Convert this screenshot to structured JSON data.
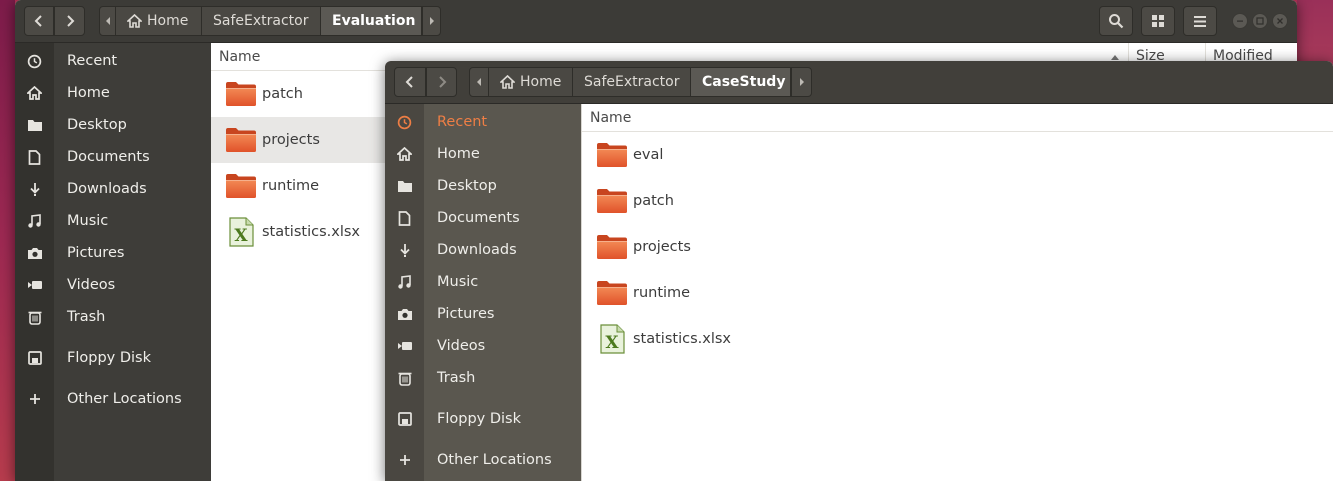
{
  "back_window": {
    "breadcrumbs": [
      "Home",
      "SafeExtractor",
      "Evaluation"
    ],
    "columns": {
      "name": "Name",
      "size": "Size",
      "modified": "Modified"
    },
    "sidebar": [
      {
        "label": "Recent",
        "icon": "clock-icon"
      },
      {
        "label": "Home",
        "icon": "home-icon"
      },
      {
        "label": "Desktop",
        "icon": "folder-icon"
      },
      {
        "label": "Documents",
        "icon": "document-icon"
      },
      {
        "label": "Downloads",
        "icon": "download-icon"
      },
      {
        "label": "Music",
        "icon": "music-icon"
      },
      {
        "label": "Pictures",
        "icon": "camera-icon"
      },
      {
        "label": "Videos",
        "icon": "video-icon"
      },
      {
        "label": "Trash",
        "icon": "trash-icon"
      },
      {
        "label": "Floppy Disk",
        "icon": "floppy-icon"
      },
      {
        "label": "Other Locations",
        "icon": "plus-icon"
      }
    ],
    "files": [
      {
        "name": "patch",
        "type": "folder"
      },
      {
        "name": "projects",
        "type": "folder",
        "selected": true
      },
      {
        "name": "runtime",
        "type": "folder"
      },
      {
        "name": "statistics.xlsx",
        "type": "spreadsheet"
      }
    ]
  },
  "front_window": {
    "breadcrumbs": [
      "Home",
      "SafeExtractor",
      "CaseStudy"
    ],
    "columns": {
      "name": "Name"
    },
    "sidebar": [
      {
        "label": "Recent",
        "icon": "clock-icon",
        "active": true
      },
      {
        "label": "Home",
        "icon": "home-icon"
      },
      {
        "label": "Desktop",
        "icon": "folder-icon"
      },
      {
        "label": "Documents",
        "icon": "document-icon"
      },
      {
        "label": "Downloads",
        "icon": "download-icon"
      },
      {
        "label": "Music",
        "icon": "music-icon"
      },
      {
        "label": "Pictures",
        "icon": "camera-icon"
      },
      {
        "label": "Videos",
        "icon": "video-icon"
      },
      {
        "label": "Trash",
        "icon": "trash-icon"
      },
      {
        "label": "Floppy Disk",
        "icon": "floppy-icon"
      },
      {
        "label": "Other Locations",
        "icon": "plus-icon"
      }
    ],
    "files": [
      {
        "name": "eval",
        "type": "folder"
      },
      {
        "name": "patch",
        "type": "folder"
      },
      {
        "name": "projects",
        "type": "folder"
      },
      {
        "name": "runtime",
        "type": "folder"
      },
      {
        "name": "statistics.xlsx",
        "type": "spreadsheet"
      }
    ]
  },
  "colors": {
    "accent": "#ee7e45",
    "headerbar": "#3c3b37",
    "sidebar_back": "#3e3d39",
    "sidebar_front": "#5a574f"
  }
}
